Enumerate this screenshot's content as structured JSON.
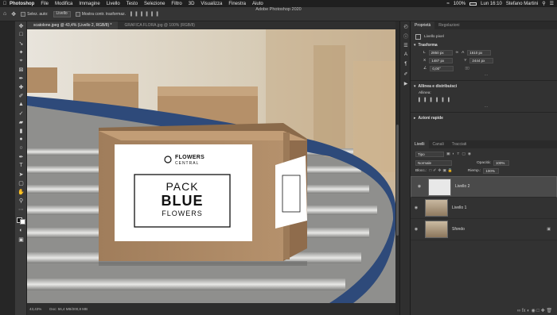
{
  "menubar": {
    "items": [
      "Photoshop",
      "File",
      "Modifica",
      "Immagine",
      "Livello",
      "Testo",
      "Selezione",
      "Filtro",
      "3D",
      "Visualizza",
      "Finestra",
      "Aiuto"
    ],
    "battery": "100%",
    "day_time": "Lun 16:10",
    "user": "Stefano Martini"
  },
  "app_title": "Adobe Photoshop 2020",
  "options": {
    "auto_select_label": "Selez. auto:",
    "auto_select_value": "Livello",
    "show_transform_label": "Mostra contr. trasformaz."
  },
  "doc_tabs": [
    {
      "label": "scatolone.jpeg @ 43,4% (Livello 2, RGB/8) *"
    },
    {
      "label": "GRAFICA FLORA.jpg @ 100% (RGB/8)"
    }
  ],
  "status": {
    "zoom": "43,43%",
    "doc": "Doc: 56,4 MB/200,8 MB"
  },
  "box_print": {
    "brand_top": "FLOWERS",
    "brand_bottom": "CENTRAL",
    "line1": "PACK",
    "line2": "BLUE",
    "line3": "FLOWERS"
  },
  "panel": {
    "tabs": [
      "Proprietà",
      "Regolazioni"
    ],
    "pixel_layer": "Livello pixel",
    "transform_title": "Trasforma",
    "transform": {
      "l": "2850 px",
      "a": "1610 px",
      "x": "1487 px",
      "y": "2444 px",
      "angle": "0,00°"
    },
    "align_title": "Allinea e distribuisci",
    "align_sub": "Allinea:",
    "quick_title": "Azioni rapide",
    "layers_tabs": [
      "Livelli",
      "Canali",
      "Tracciati"
    ],
    "kind": "Tipo",
    "blend": "Normale",
    "opacity_label": "Opacità:",
    "opacity": "100%",
    "lock_label": "Blocc.:",
    "fill_label": "Riemp.:",
    "fill": "100%",
    "layers": [
      {
        "name": "Livello 2"
      },
      {
        "name": "Livello 1"
      },
      {
        "name": "Sfondo"
      }
    ]
  }
}
